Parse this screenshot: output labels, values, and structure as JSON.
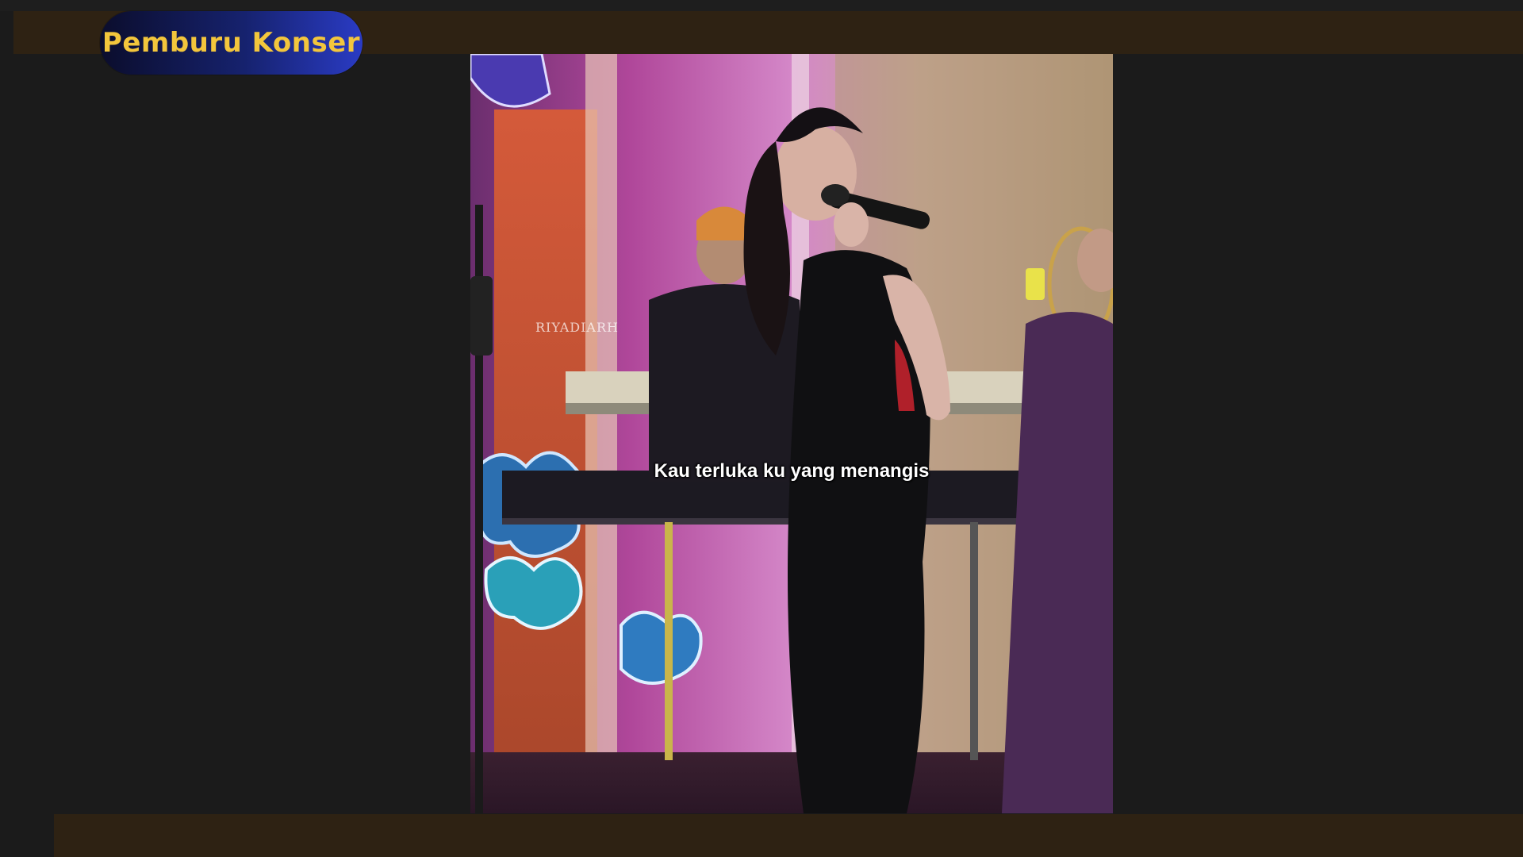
{
  "brand": {
    "name": "Pemburu Konser"
  },
  "video": {
    "watermark": "RIYADIARH",
    "subtitle": "Kau terluka ku yang menangis"
  },
  "colors": {
    "background": "#1b1b1b",
    "band": "#2e2213",
    "brand_text": "#f3c63c",
    "brand_badge_start": "#0b0d2c",
    "brand_badge_end": "#2a3bc4"
  }
}
